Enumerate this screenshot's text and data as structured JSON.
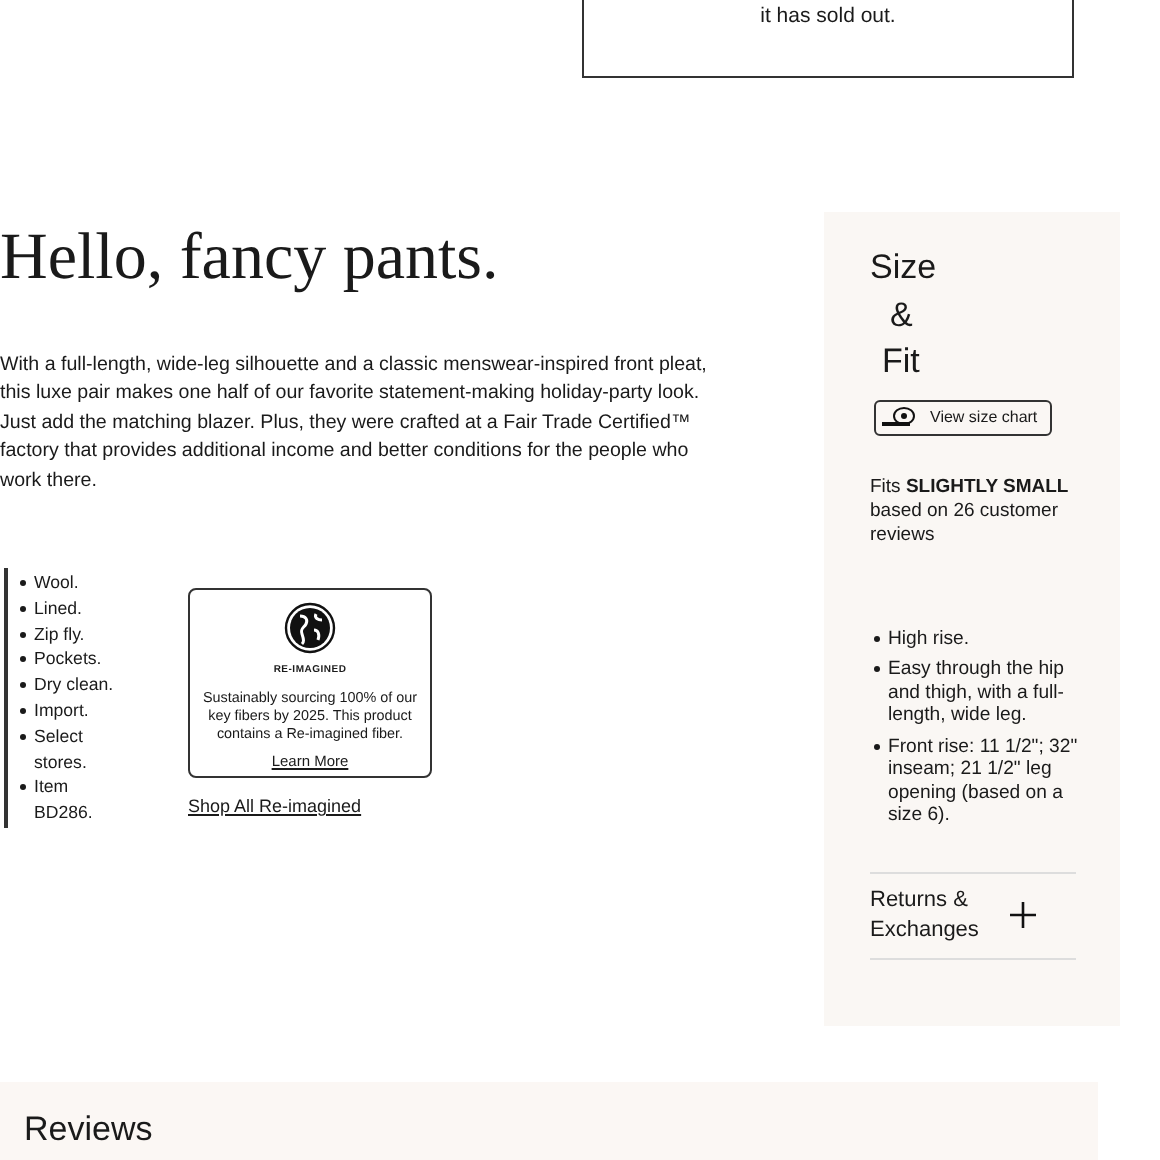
{
  "notice": {
    "text": "it has sold out."
  },
  "product": {
    "title": "Hello, fancy pants.",
    "description": "With a full-length, wide-leg silhouette and a classic menswear-inspired front pleat, this luxe pair makes one half of our favorite statement-making holiday-party look. Just add the matching blazer. Plus, they were crafted at a Fair Trade Certified™ factory that provides additional income and better conditions for the people who work there.",
    "details": [
      "Wool.",
      "Lined.",
      "Zip fly.",
      "Pockets.",
      "Dry clean.",
      "Import.",
      "Select stores.",
      "Item BD286."
    ]
  },
  "reimagined": {
    "badge": "RE-IMAGINED",
    "text": "Sustainably sourcing 100% of our key fibers by 2025. This product contains a Re-imagined fiber.",
    "link": "Learn More",
    "shop_link": "Shop All Re-imagined"
  },
  "size_fit": {
    "title_lines": [
      "Size",
      "&",
      "Fit"
    ],
    "size_chart_button": "View size chart",
    "fit_summary": "Fits **SLIGHTLY SMALL** based on 26 customer reviews",
    "fit_notes": [
      "High rise.",
      "Easy through the hip and thigh, with a full-length, wide leg.",
      "Front rise: 11 1/2\"; 32\" inseam; 21 1/2\" leg opening (based on a size 6)."
    ],
    "accordion": {
      "label": "Returns & Exchanges",
      "expanded": false
    }
  },
  "reviews": {
    "title": "Reviews"
  }
}
